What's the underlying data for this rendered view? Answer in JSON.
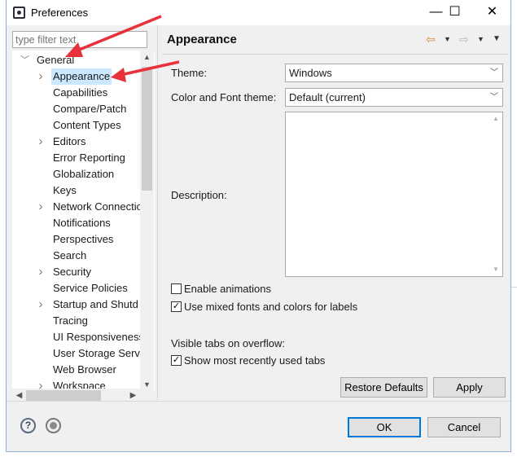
{
  "window": {
    "title": "Preferences",
    "minimize_glyph": "—",
    "maximize_glyph": "☐",
    "close_glyph": "✕"
  },
  "tree": {
    "filter_placeholder": "type filter text",
    "items": [
      {
        "label": "General",
        "level": 0,
        "twisty": "expanded"
      },
      {
        "label": "Appearance",
        "level": 1,
        "twisty": "collapsed",
        "selected": true
      },
      {
        "label": "Capabilities",
        "level": 1,
        "twisty": "none"
      },
      {
        "label": "Compare/Patch",
        "level": 1,
        "twisty": "none"
      },
      {
        "label": "Content Types",
        "level": 1,
        "twisty": "none"
      },
      {
        "label": "Editors",
        "level": 1,
        "twisty": "collapsed"
      },
      {
        "label": "Error Reporting",
        "level": 1,
        "twisty": "none"
      },
      {
        "label": "Globalization",
        "level": 1,
        "twisty": "none"
      },
      {
        "label": "Keys",
        "level": 1,
        "twisty": "none"
      },
      {
        "label": "Network Connectio",
        "level": 1,
        "twisty": "collapsed"
      },
      {
        "label": "Notifications",
        "level": 1,
        "twisty": "none"
      },
      {
        "label": "Perspectives",
        "level": 1,
        "twisty": "none"
      },
      {
        "label": "Search",
        "level": 1,
        "twisty": "none"
      },
      {
        "label": "Security",
        "level": 1,
        "twisty": "collapsed"
      },
      {
        "label": "Service Policies",
        "level": 1,
        "twisty": "none"
      },
      {
        "label": "Startup and Shutd",
        "level": 1,
        "twisty": "collapsed"
      },
      {
        "label": "Tracing",
        "level": 1,
        "twisty": "none"
      },
      {
        "label": "UI Responsiveness",
        "level": 1,
        "twisty": "none"
      },
      {
        "label": "User Storage Serv",
        "level": 1,
        "twisty": "none"
      },
      {
        "label": "Web Browser",
        "level": 1,
        "twisty": "none"
      },
      {
        "label": "Workspace",
        "level": 1,
        "twisty": "collapsed"
      }
    ]
  },
  "page": {
    "title": "Appearance",
    "theme_label": "Theme:",
    "theme_value": "Windows",
    "color_font_theme_label": "Color and Font theme:",
    "color_font_theme_value": "Default (current)",
    "description_label": "Description:",
    "enable_animations_label": "Enable animations",
    "enable_animations_checked": false,
    "mixed_fonts_label": "Use mixed fonts and colors for labels",
    "mixed_fonts_checked": true,
    "visible_tabs_label": "Visible tabs on overflow:",
    "show_recent_tabs_label": "Show most recently used tabs",
    "show_recent_tabs_checked": true,
    "restore_defaults_label": "Restore Defaults",
    "apply_label": "Apply"
  },
  "footer": {
    "ok_label": "OK",
    "cancel_label": "Cancel",
    "help_glyph": "?"
  },
  "colors": {
    "selection": "#cce8ff",
    "annotation_arrow": "#e8313a",
    "accent_border": "#0078d7"
  }
}
